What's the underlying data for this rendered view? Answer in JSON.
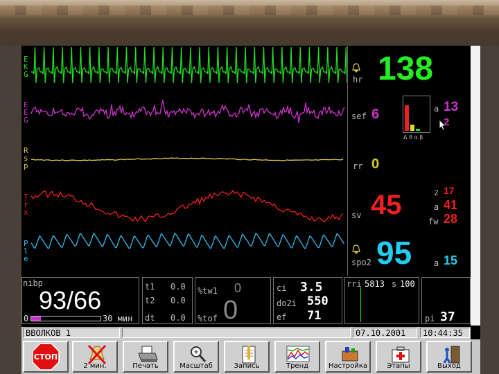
{
  "waveform_labels": {
    "ekg": "EKG",
    "eeg": "EEG",
    "rsp": "Rsp",
    "trx": "Trx",
    "ple": "Ple"
  },
  "params": {
    "hr": {
      "label": "hr",
      "value": "138"
    },
    "sef": {
      "label": "sef",
      "value": "6"
    },
    "a_top": {
      "label": "a",
      "value": "13"
    },
    "pointer_value": "2",
    "eeg_bands": "Δ θ α β",
    "rr": {
      "label": "rr",
      "value": "0"
    },
    "z": {
      "label": "z",
      "value": "17"
    },
    "sv": {
      "label": "sv",
      "value": "45"
    },
    "a_mid": {
      "label": "a",
      "value": "41"
    },
    "fw": {
      "label": "fw",
      "value": "28"
    },
    "spo2": {
      "label": "spo2",
      "value": "95"
    },
    "a_bottom": {
      "label": "a",
      "value": "15"
    }
  },
  "bottom": {
    "nibp": {
      "label": "nibp",
      "value": "93/66",
      "scale_min": "0",
      "scale_max": "30 мин",
      "progress": 0.14
    },
    "timers": [
      {
        "label": "t1",
        "value": "0.0"
      },
      {
        "label": "t2",
        "value": "0.0"
      },
      {
        "label": "dt",
        "value": "0.0"
      }
    ],
    "tw1": {
      "label": "%tw1",
      "value": "0"
    },
    "tof": {
      "label": "%tof",
      "value": "0"
    },
    "ci": {
      "label": "ci",
      "value": "3.5"
    },
    "do2i": {
      "label": "do2i",
      "value": "550"
    },
    "ef": {
      "label": "ef",
      "value": "71"
    },
    "rri": {
      "label": "rri",
      "value": "5813",
      "s_label": "s",
      "s_value": "100"
    },
    "pi": {
      "label": "pi",
      "value": "37"
    }
  },
  "status": {
    "patient": "ВВОЛКОВ 1",
    "date": "07.10.2001",
    "time": "10:44:35"
  },
  "toolbar": {
    "stop": "СТОП",
    "mute": "2 мин.",
    "print": "Печать",
    "scale": "Масштаб",
    "record": "Запись",
    "trend": "Тренд",
    "settings": "Настройка",
    "stages": "Этапы",
    "exit": "Выход"
  },
  "colors": {
    "ekg": "#22dd22",
    "eeg": "#cc33cc",
    "rsp": "#ddcc44",
    "trx": "#ee2020",
    "ple": "#33bbee"
  }
}
